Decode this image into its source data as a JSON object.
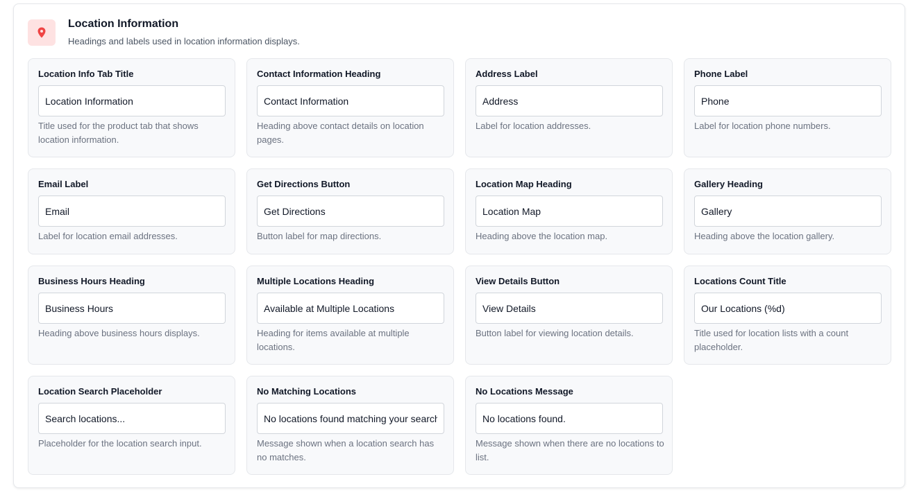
{
  "section": {
    "title": "Location Information",
    "description": "Headings and labels used in location information displays.",
    "icon": "map-pin-icon",
    "icon_color": "#ef4444",
    "icon_bg": "#fee2e2"
  },
  "fields": [
    {
      "label": "Location Info Tab Title",
      "value": "Location Information",
      "help": "Title used for the product tab that shows location information."
    },
    {
      "label": "Contact Information Heading",
      "value": "Contact Information",
      "help": "Heading above contact details on location pages."
    },
    {
      "label": "Address Label",
      "value": "Address",
      "help": "Label for location addresses."
    },
    {
      "label": "Phone Label",
      "value": "Phone",
      "help": "Label for location phone numbers."
    },
    {
      "label": "Email Label",
      "value": "Email",
      "help": "Label for location email addresses."
    },
    {
      "label": "Get Directions Button",
      "value": "Get Directions",
      "help": "Button label for map directions."
    },
    {
      "label": "Location Map Heading",
      "value": "Location Map",
      "help": "Heading above the location map."
    },
    {
      "label": "Gallery Heading",
      "value": "Gallery",
      "help": "Heading above the location gallery."
    },
    {
      "label": "Business Hours Heading",
      "value": "Business Hours",
      "help": "Heading above business hours displays."
    },
    {
      "label": "Multiple Locations Heading",
      "value": "Available at Multiple Locations",
      "help": "Heading for items available at multiple locations."
    },
    {
      "label": "View Details Button",
      "value": "View Details",
      "help": "Button label for viewing location details."
    },
    {
      "label": "Locations Count Title",
      "value": "Our Locations (%d)",
      "help": "Title used for location lists with a count placeholder."
    },
    {
      "label": "Location Search Placeholder",
      "value": "Search locations...",
      "help": "Placeholder for the location search input."
    },
    {
      "label": "No Matching Locations",
      "value": "No locations found matching your search.",
      "help": "Message shown when a location search has no matches."
    },
    {
      "label": "No Locations Message",
      "value": "No locations found.",
      "help": "Message shown when there are no locations to list."
    }
  ]
}
